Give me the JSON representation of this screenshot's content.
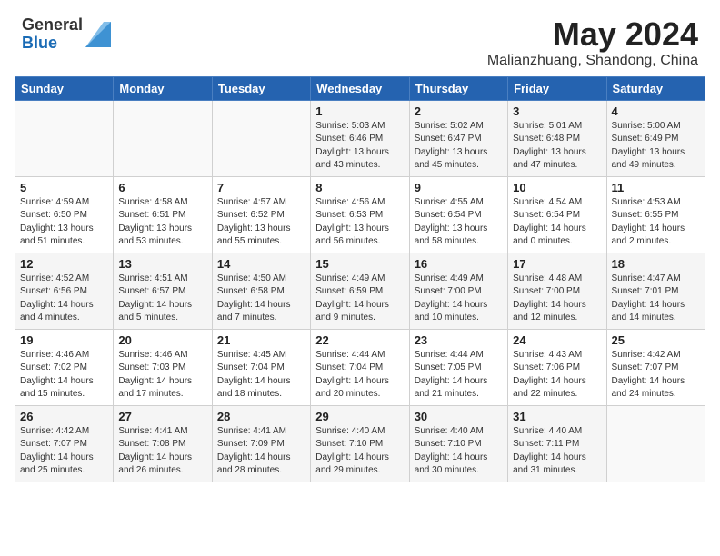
{
  "header": {
    "logo_general": "General",
    "logo_blue": "Blue",
    "month_title": "May 2024",
    "location": "Malianzhuang, Shandong, China"
  },
  "days_of_week": [
    "Sunday",
    "Monday",
    "Tuesday",
    "Wednesday",
    "Thursday",
    "Friday",
    "Saturday"
  ],
  "weeks": [
    [
      {
        "day": "",
        "info": ""
      },
      {
        "day": "",
        "info": ""
      },
      {
        "day": "",
        "info": ""
      },
      {
        "day": "1",
        "info": "Sunrise: 5:03 AM\nSunset: 6:46 PM\nDaylight: 13 hours\nand 43 minutes."
      },
      {
        "day": "2",
        "info": "Sunrise: 5:02 AM\nSunset: 6:47 PM\nDaylight: 13 hours\nand 45 minutes."
      },
      {
        "day": "3",
        "info": "Sunrise: 5:01 AM\nSunset: 6:48 PM\nDaylight: 13 hours\nand 47 minutes."
      },
      {
        "day": "4",
        "info": "Sunrise: 5:00 AM\nSunset: 6:49 PM\nDaylight: 13 hours\nand 49 minutes."
      }
    ],
    [
      {
        "day": "5",
        "info": "Sunrise: 4:59 AM\nSunset: 6:50 PM\nDaylight: 13 hours\nand 51 minutes."
      },
      {
        "day": "6",
        "info": "Sunrise: 4:58 AM\nSunset: 6:51 PM\nDaylight: 13 hours\nand 53 minutes."
      },
      {
        "day": "7",
        "info": "Sunrise: 4:57 AM\nSunset: 6:52 PM\nDaylight: 13 hours\nand 55 minutes."
      },
      {
        "day": "8",
        "info": "Sunrise: 4:56 AM\nSunset: 6:53 PM\nDaylight: 13 hours\nand 56 minutes."
      },
      {
        "day": "9",
        "info": "Sunrise: 4:55 AM\nSunset: 6:54 PM\nDaylight: 13 hours\nand 58 minutes."
      },
      {
        "day": "10",
        "info": "Sunrise: 4:54 AM\nSunset: 6:54 PM\nDaylight: 14 hours\nand 0 minutes."
      },
      {
        "day": "11",
        "info": "Sunrise: 4:53 AM\nSunset: 6:55 PM\nDaylight: 14 hours\nand 2 minutes."
      }
    ],
    [
      {
        "day": "12",
        "info": "Sunrise: 4:52 AM\nSunset: 6:56 PM\nDaylight: 14 hours\nand 4 minutes."
      },
      {
        "day": "13",
        "info": "Sunrise: 4:51 AM\nSunset: 6:57 PM\nDaylight: 14 hours\nand 5 minutes."
      },
      {
        "day": "14",
        "info": "Sunrise: 4:50 AM\nSunset: 6:58 PM\nDaylight: 14 hours\nand 7 minutes."
      },
      {
        "day": "15",
        "info": "Sunrise: 4:49 AM\nSunset: 6:59 PM\nDaylight: 14 hours\nand 9 minutes."
      },
      {
        "day": "16",
        "info": "Sunrise: 4:49 AM\nSunset: 7:00 PM\nDaylight: 14 hours\nand 10 minutes."
      },
      {
        "day": "17",
        "info": "Sunrise: 4:48 AM\nSunset: 7:00 PM\nDaylight: 14 hours\nand 12 minutes."
      },
      {
        "day": "18",
        "info": "Sunrise: 4:47 AM\nSunset: 7:01 PM\nDaylight: 14 hours\nand 14 minutes."
      }
    ],
    [
      {
        "day": "19",
        "info": "Sunrise: 4:46 AM\nSunset: 7:02 PM\nDaylight: 14 hours\nand 15 minutes."
      },
      {
        "day": "20",
        "info": "Sunrise: 4:46 AM\nSunset: 7:03 PM\nDaylight: 14 hours\nand 17 minutes."
      },
      {
        "day": "21",
        "info": "Sunrise: 4:45 AM\nSunset: 7:04 PM\nDaylight: 14 hours\nand 18 minutes."
      },
      {
        "day": "22",
        "info": "Sunrise: 4:44 AM\nSunset: 7:04 PM\nDaylight: 14 hours\nand 20 minutes."
      },
      {
        "day": "23",
        "info": "Sunrise: 4:44 AM\nSunset: 7:05 PM\nDaylight: 14 hours\nand 21 minutes."
      },
      {
        "day": "24",
        "info": "Sunrise: 4:43 AM\nSunset: 7:06 PM\nDaylight: 14 hours\nand 22 minutes."
      },
      {
        "day": "25",
        "info": "Sunrise: 4:42 AM\nSunset: 7:07 PM\nDaylight: 14 hours\nand 24 minutes."
      }
    ],
    [
      {
        "day": "26",
        "info": "Sunrise: 4:42 AM\nSunset: 7:07 PM\nDaylight: 14 hours\nand 25 minutes."
      },
      {
        "day": "27",
        "info": "Sunrise: 4:41 AM\nSunset: 7:08 PM\nDaylight: 14 hours\nand 26 minutes."
      },
      {
        "day": "28",
        "info": "Sunrise: 4:41 AM\nSunset: 7:09 PM\nDaylight: 14 hours\nand 28 minutes."
      },
      {
        "day": "29",
        "info": "Sunrise: 4:40 AM\nSunset: 7:10 PM\nDaylight: 14 hours\nand 29 minutes."
      },
      {
        "day": "30",
        "info": "Sunrise: 4:40 AM\nSunset: 7:10 PM\nDaylight: 14 hours\nand 30 minutes."
      },
      {
        "day": "31",
        "info": "Sunrise: 4:40 AM\nSunset: 7:11 PM\nDaylight: 14 hours\nand 31 minutes."
      },
      {
        "day": "",
        "info": ""
      }
    ]
  ]
}
